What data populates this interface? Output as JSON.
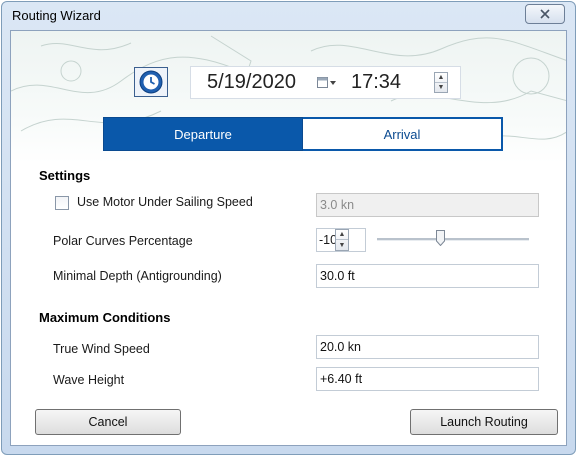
{
  "window": {
    "title": "Routing Wizard",
    "close_glyph": "X"
  },
  "datetime": {
    "date": "5/19/2020",
    "time": "17:34",
    "clock_icon": "clock-icon",
    "calendar_icon": "calendar-dropdown-icon"
  },
  "mode_tabs": [
    {
      "label": "Departure",
      "selected": true
    },
    {
      "label": "Arrival",
      "selected": false
    }
  ],
  "settings": {
    "heading": "Settings",
    "motor": {
      "label": "Use Motor Under Sailing Speed",
      "checked": false,
      "value": "3.0 kn"
    },
    "polar": {
      "label": "Polar Curves Percentage",
      "value": "-10"
    },
    "depth": {
      "label": "Minimal Depth (Antigrounding)",
      "value": "30.0 ft"
    }
  },
  "max_conditions": {
    "heading": "Maximum Conditions",
    "wind": {
      "label": "True Wind Speed",
      "value": "20.0 kn"
    },
    "wave": {
      "label": "Wave Height",
      "value": "+6.40 ft"
    }
  },
  "buttons": {
    "cancel": "Cancel",
    "launch": "Launch Routing"
  },
  "colors": {
    "accent": "#0a58aa",
    "window_frame": "#c8d9ee"
  }
}
